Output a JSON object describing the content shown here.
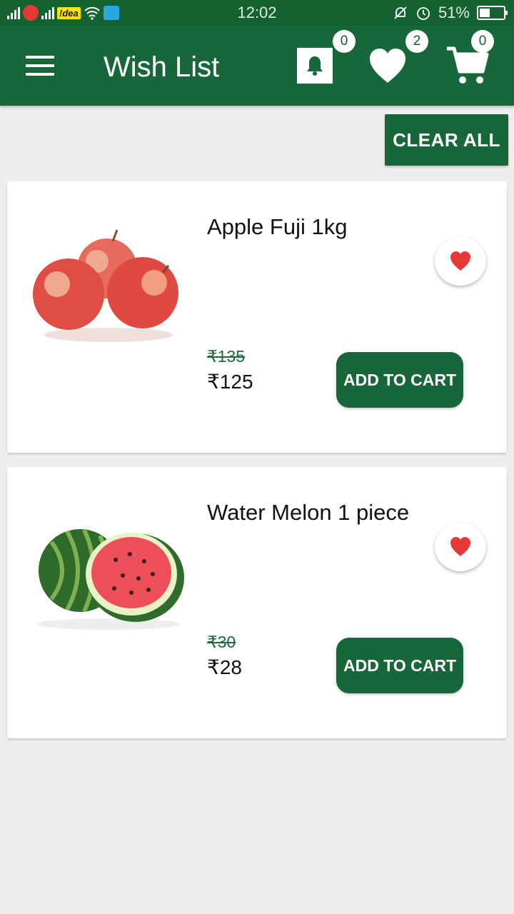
{
  "status_bar": {
    "carrier": "!dea",
    "time": "12:02",
    "battery_text": "51%",
    "battery_level": 0.51
  },
  "header": {
    "title": "Wish List",
    "notification_count": "0",
    "wishlist_count": "2",
    "cart_count": "0"
  },
  "toolbar": {
    "clear_all_label": "CLEAR ALL"
  },
  "products": [
    {
      "name": "Apple Fuji 1kg",
      "old_price": "₹135",
      "price": "₹125",
      "add_label": "ADD TO CART"
    },
    {
      "name": "Water Melon 1 piece",
      "old_price": "₹30",
      "price": "₹28",
      "add_label": "ADD TO CART"
    }
  ],
  "colors": {
    "primary": "#17673a",
    "status_bar": "#13622f",
    "heart": "#e53935",
    "background": "#eeeeee"
  },
  "icons": [
    "menu-icon",
    "bell-icon",
    "heart-icon",
    "cart-icon",
    "favorite-heart-icon"
  ]
}
